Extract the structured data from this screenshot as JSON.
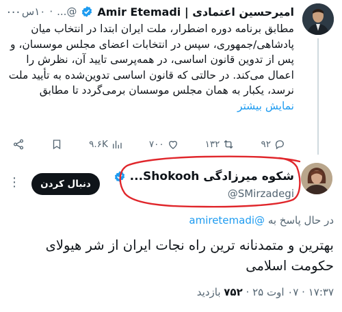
{
  "parent_tweet": {
    "display_name": "امیرحسین اعتمادی | Amir Etemadi",
    "handle": "@...",
    "dot": "·",
    "time": "۱۰س",
    "text": "مطابق برنامه دوره اضطرار، ملت ایران ابتدا در انتخاب میان پادشاهی/جمهوری، سپس در انتخابات اعضای مجلس موسسان، و پس از تدوین قانون اساسی، در همه‌پرسی تایید آن، نظرش را اعمال می‌کند. در حالتی که قانون اساسی تدوین‌شده به تأیید ملت نرسد، یکبار به همان مجلس موسسان برمی‌گردد تا مطابق",
    "show_more": "نمایش بیشتر",
    "actions": {
      "replies": "۹۲",
      "retweets": "۱۳۲",
      "likes": "۷۰۰",
      "views": "۹.۶K"
    }
  },
  "reply_tweet": {
    "display_name": "شکوه میرزادگی Shokooh...",
    "handle": "@SMirzadegi",
    "follow_label": "دنبال کردن",
    "replying_prefix": "در حال پاسخ به",
    "replying_to": "@amiretemadi",
    "text": "بهترین و متمدنانه ترین راه نجات ایران از شر هیولای حکومت اسلامی",
    "timestamp": "۱۷:۳۷ · ۰۷ اوت ۲۵ ·",
    "views": "۷۵۲",
    "views_label": "بازدید"
  },
  "colors": {
    "accent": "#1d9bf0",
    "annotation": "#e0262b",
    "text": "#0f1419",
    "muted": "#536471"
  }
}
